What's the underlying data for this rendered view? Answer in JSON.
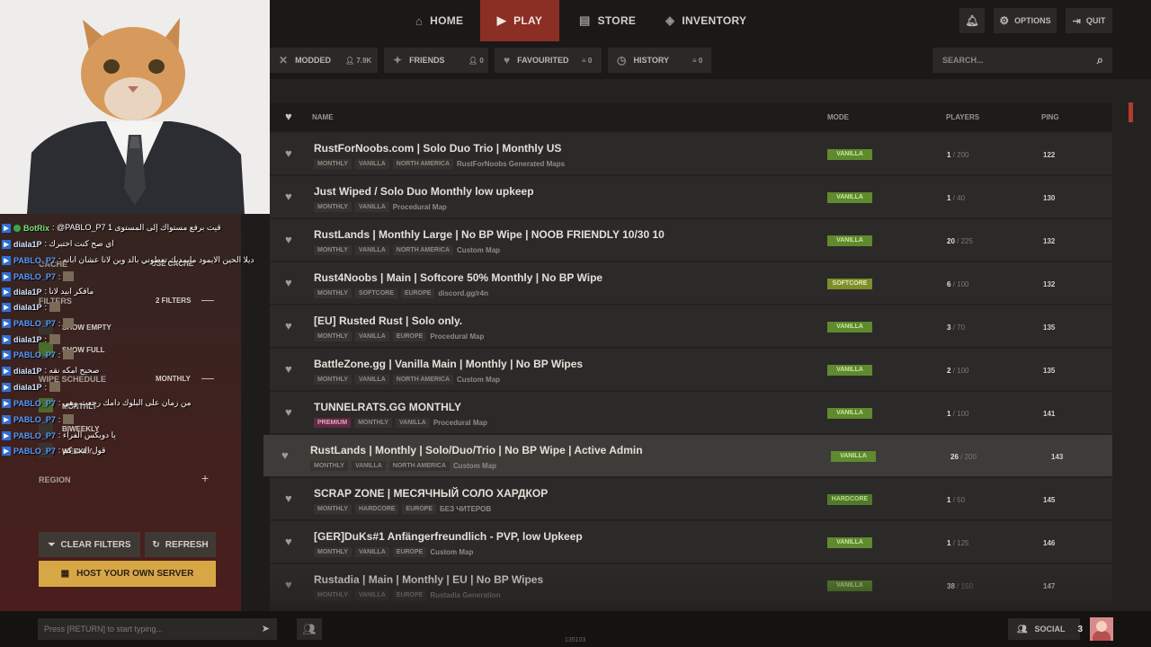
{
  "nav": {
    "home": "HOME",
    "play": "PLAY",
    "store": "STORE",
    "inventory": "INVENTORY",
    "options": "OPTIONS",
    "quit": "QUIT"
  },
  "tabs": {
    "modded": "MODDED",
    "modded_count": "7.9K",
    "friends": "FRIENDS",
    "friends_count": "0",
    "favourited": "FAVOURITED",
    "favourited_count": "0",
    "history": "HISTORY",
    "history_count": "0",
    "search_placeholder": "SEARCH..."
  },
  "table": {
    "col_name": "NAME",
    "col_mode": "MODE",
    "col_players": "PLAYERS",
    "col_ping": "PING"
  },
  "servers": [
    {
      "name": "RustForNoobs.com | Solo Duo Trio | Monthly US",
      "tags": [
        "MONTHLY",
        "VANILLA",
        "NORTH AMERICA"
      ],
      "extra": "RustForNoobs Generated Maps",
      "mode": "VANILLA",
      "players": "1",
      "max": "/ 200",
      "ping": "122"
    },
    {
      "name": "Just Wiped / Solo Duo Monthly low upkeep",
      "tags": [
        "MONTHLY",
        "VANILLA"
      ],
      "extra": "Procedural Map",
      "mode": "VANILLA",
      "players": "1",
      "max": "/ 40",
      "ping": "130"
    },
    {
      "name": "RustLands | Monthly Large | No BP Wipe | NOOB FRIENDLY 10/30 10",
      "tags": [
        "MONTHLY",
        "VANILLA",
        "NORTH AMERICA"
      ],
      "extra": "Custom Map",
      "mode": "VANILLA",
      "players": "20",
      "max": "/ 225",
      "ping": "132"
    },
    {
      "name": "Rust4Noobs | Main | Softcore 50% Monthly | No BP Wipe",
      "tags": [
        "MONTHLY",
        "SOFTCORE",
        "EUROPE"
      ],
      "extra": "discord.gg/r4n",
      "mode": "SOFTCORE",
      "players": "6",
      "max": "/ 100",
      "ping": "132"
    },
    {
      "name": "[EU] Rusted Rust | Solo only.",
      "tags": [
        "MONTHLY",
        "VANILLA",
        "EUROPE"
      ],
      "extra": "Procedural Map",
      "mode": "VANILLA",
      "players": "3",
      "max": "/ 70",
      "ping": "135"
    },
    {
      "name": "BattleZone.gg | Vanilla Main | Monthly | No BP Wipes",
      "tags": [
        "MONTHLY",
        "VANILLA",
        "NORTH AMERICA"
      ],
      "extra": "Custom Map",
      "mode": "VANILLA",
      "players": "2",
      "max": "/ 100",
      "ping": "135"
    },
    {
      "name": "TUNNELRATS.GG MONTHLY",
      "tags": [
        "PREMIUM",
        "MONTHLY",
        "VANILLA"
      ],
      "extra": "Procedural Map",
      "mode": "VANILLA",
      "players": "1",
      "max": "/ 100",
      "ping": "141"
    },
    {
      "name": "RustLands | Monthly | Solo/Duo/Trio | No BP Wipe | Active Admin",
      "tags": [
        "MONTHLY",
        "VANILLA",
        "NORTH AMERICA"
      ],
      "extra": "Custom Map",
      "mode": "VANILLA",
      "players": "26",
      "max": "/ 200",
      "ping": "143"
    },
    {
      "name": "SCRAP ZONE | МЕСЯЧНЫЙ СОЛО ХАРДКОР",
      "tags": [
        "MONTHLY",
        "HARDCORE",
        "EUROPE"
      ],
      "extra": "БЕЗ ЧИТЕРОВ",
      "mode": "HARDCORE",
      "players": "1",
      "max": "/ 50",
      "ping": "145"
    },
    {
      "name": "[GER]DuKs#1 Anfängerfreundlich - PVP, low Upkeep",
      "tags": [
        "MONTHLY",
        "VANILLA",
        "EUROPE"
      ],
      "extra": "Custom Map",
      "mode": "VANILLA",
      "players": "1",
      "max": "/ 125",
      "ping": "146"
    },
    {
      "name": "Rustadia | Main | Monthly | EU | No BP Wipes",
      "tags": [
        "MONTHLY",
        "VANILLA",
        "EUROPE"
      ],
      "extra": "Rustadia Generation",
      "mode": "VANILLA",
      "players": "38",
      "max": "/ 150",
      "ping": "147"
    }
  ],
  "sidebar": {
    "cache": "CACHE",
    "use_cache": "USE CACHE",
    "filters": "FILTERS",
    "filters_count": "2 FILTERS",
    "show_empty": "SHOW EMPTY",
    "show_full": "SHOW FULL",
    "wipe_schedule": "WIPE SCHEDULE",
    "wipe_value": "MONTHLY",
    "monthly": "MONTHLY",
    "biweekly": "BIWEEKLY",
    "weekly": "WEEKLY",
    "region": "REGION",
    "clear_filters": "CLEAR FILTERS",
    "refresh": "REFRESH",
    "host": "HOST YOUR OWN SERVER"
  },
  "chat_overlay": [
    {
      "user": "BotRix",
      "msg": ": @PABLO_P7 1 قيت برفع مستواك إلى المستوى",
      "color": "#7ee07e"
    },
    {
      "user": "diala1P",
      "msg": ": اي صح كنت اختبرك",
      "color": "#cfe6ff"
    },
    {
      "user": "PABLO_P7",
      "msg": ": ديلا الحين الايمود مايمديك تعطوني بالد وين لانا عشان ابانه",
      "color": "#5b9cff"
    },
    {
      "user": "PABLO_P7",
      "msg": ":",
      "color": "#5b9cff"
    },
    {
      "user": "diala1P",
      "msg": ": مافكر ابيد لانا",
      "color": "#cfe6ff"
    },
    {
      "user": "diala1P",
      "msg": ":",
      "color": "#cfe6ff"
    },
    {
      "user": "PABLO_P7",
      "msg": ":",
      "color": "#5b9cff"
    },
    {
      "user": "diala1P",
      "msg": ":",
      "color": "#cfe6ff"
    },
    {
      "user": "PABLO_P7",
      "msg": ":",
      "color": "#5b9cff"
    },
    {
      "user": "diala1P",
      "msg": ": صحيح امكه نقه",
      "color": "#cfe6ff"
    },
    {
      "user": "diala1P",
      "msg": ":",
      "color": "#cfe6ff"
    },
    {
      "user": "PABLO_P7",
      "msg": ": من زمان على البلوك دامك رجعت وهي",
      "color": "#5b9cff"
    },
    {
      "user": "PABLO_P7",
      "msg": ":",
      "color": "#5b9cff"
    },
    {
      "user": "PABLO_P7",
      "msg": ": يا دويكس الفراء",
      "color": "#5b9cff"
    },
    {
      "user": "PABLO_P7",
      "msg": ": قول البث كم",
      "color": "#5b9cff"
    }
  ],
  "bottom": {
    "chat_placeholder": "Press [RETURN] to start typing...",
    "build": "135103",
    "social": "SOCIAL",
    "social_count": "3"
  }
}
